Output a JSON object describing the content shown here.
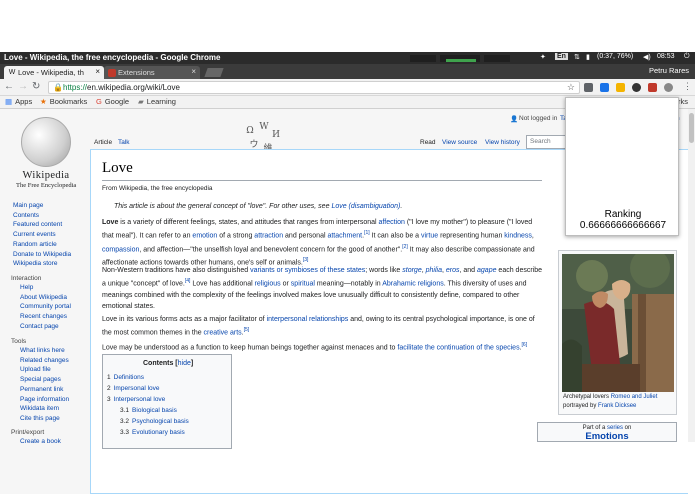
{
  "window": {
    "title": "Love - Wikipedia, the free encyclopedia - Google Chrome",
    "battery": "(0:37, 76%)",
    "time": "08:53",
    "keyboard_layout": "En",
    "user_profile": "Petru Rares"
  },
  "tabs": [
    {
      "label": "Love - Wikipedia, th",
      "active": true,
      "favicon": "W"
    },
    {
      "label": "Extensions",
      "active": false,
      "favicon": "puzzle-icon"
    }
  ],
  "address_bar": {
    "scheme": "https://",
    "host_path": "en.wikipedia.org/wiki/Love"
  },
  "bookmarks": [
    {
      "label": "Apps",
      "icon": "apps-grid-icon"
    },
    {
      "label": "Bookmarks",
      "icon": "star-icon"
    },
    {
      "label": "Google",
      "icon": "google-icon"
    },
    {
      "label": "Learning",
      "icon": "folder-icon"
    }
  ],
  "bookmarks_overflow_label": "rks",
  "wiki": {
    "logo_wordmark": "Wikipedia",
    "logo_tagline": "The Free Encyclopedia",
    "not_logged_in": "Not logged in",
    "talk_partial": "Ta",
    "log_partial": "n",
    "nav_links": [
      "Main page",
      "Contents",
      "Featured content",
      "Current events",
      "Random article",
      "Donate to Wikipedia",
      "Wikipedia store"
    ],
    "interaction": {
      "heading": "Interaction",
      "links": [
        "Help",
        "About Wikipedia",
        "Community portal",
        "Recent changes",
        "Contact page"
      ]
    },
    "tools": {
      "heading": "Tools",
      "links": [
        "What links here",
        "Related changes",
        "Upload file",
        "Special pages",
        "Permanent link",
        "Page information",
        "Wikidata item",
        "Cite this page"
      ]
    },
    "print_export": {
      "heading": "Print/export",
      "links": [
        "Create a book"
      ]
    },
    "content_tabs": {
      "article": "Article",
      "talk": "Talk",
      "read": "Read",
      "view_source": "View source",
      "view_history": "View history",
      "search_placeholder": "Search"
    },
    "page_title": "Love",
    "from": "From Wikipedia, the free encyclopedia",
    "hatnote": {
      "text": "This article is about the general concept of \"love\". For other uses, see",
      "link": "Love (disambiguation)",
      "end": "."
    },
    "contents": {
      "title": "Contents",
      "hide": "hide",
      "items": [
        {
          "num": "1",
          "label": "Definitions"
        },
        {
          "num": "2",
          "label": "Impersonal love"
        },
        {
          "num": "3",
          "label": "Interpersonal love"
        },
        {
          "num": "3.1",
          "label": "Biological basis"
        },
        {
          "num": "3.2",
          "label": "Psychological basis"
        },
        {
          "num": "3.3",
          "label": "Evolutionary basis"
        }
      ]
    },
    "figure": {
      "caption_prefix": "Archetypal lovers",
      "caption_link1": "Romeo and Juliet",
      "caption_middle": "portrayed by",
      "caption_link2": "Frank Dicksee"
    },
    "navbox": {
      "prefix": "Part of a",
      "link": "series",
      "suffix": "on",
      "title": "Emotions"
    }
  },
  "popup": {
    "label": "Ranking",
    "value": "0.66666666666667"
  }
}
